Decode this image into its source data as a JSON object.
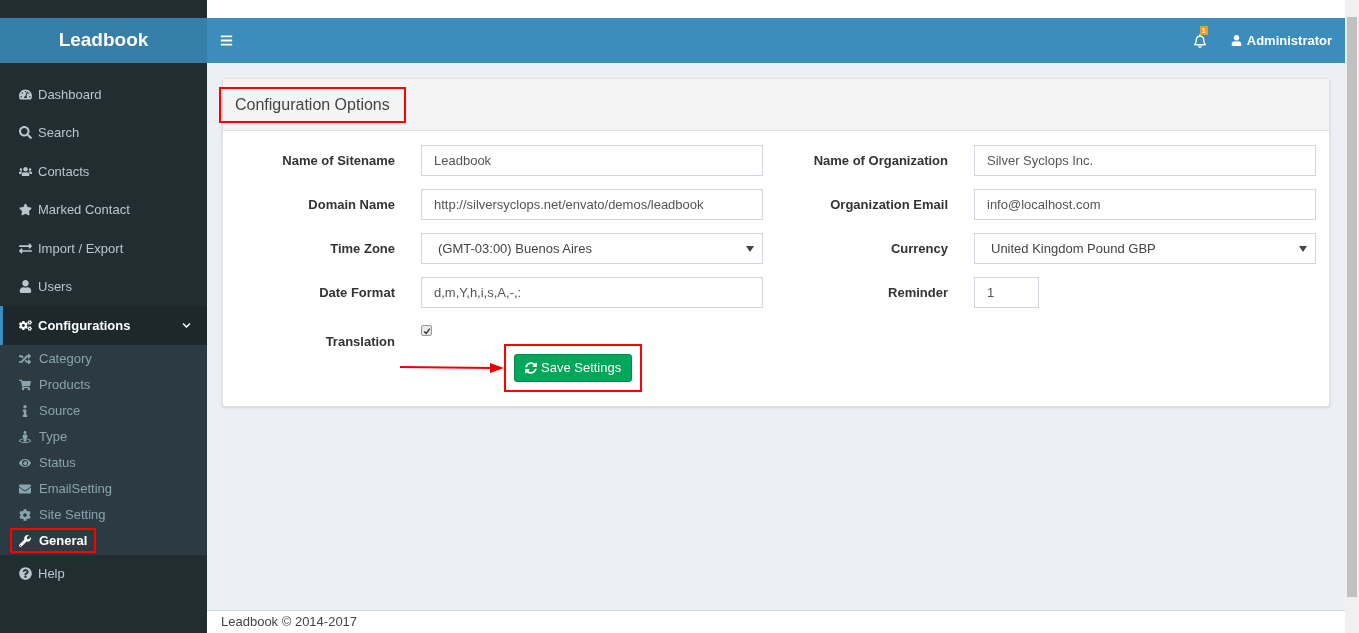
{
  "brand": "Leadbook",
  "sidebar": {
    "items": [
      {
        "label": "Dashboard",
        "selected": false
      },
      {
        "label": "Search",
        "selected": false
      },
      {
        "label": "Contacts",
        "selected": false
      },
      {
        "label": "Marked Contact",
        "selected": false
      },
      {
        "label": "Import / Export",
        "selected": false
      },
      {
        "label": "Users",
        "selected": false
      },
      {
        "label": "Configurations",
        "selected": true,
        "expanded": true,
        "children": [
          {
            "label": "Category",
            "selected": false
          },
          {
            "label": "Products",
            "selected": false
          },
          {
            "label": "Source",
            "selected": false
          },
          {
            "label": "Type",
            "selected": false
          },
          {
            "label": "Status",
            "selected": false
          },
          {
            "label": "EmailSetting",
            "selected": false
          },
          {
            "label": "Site Setting",
            "selected": false
          },
          {
            "label": "General",
            "selected": true,
            "highlighted": true
          }
        ]
      },
      {
        "label": "Help",
        "selected": false
      }
    ]
  },
  "header": {
    "notification_count": "1",
    "user": "Administrator"
  },
  "panel": {
    "title": "Configuration Options",
    "title_highlighted": true,
    "left_fields": [
      {
        "kind": "text",
        "label": "Name of Sitename",
        "value": "Leadbook"
      },
      {
        "kind": "text",
        "label": "Domain Name",
        "value": "http://silversyclops.net/envato/demos/leadbook"
      },
      {
        "kind": "select",
        "label": "Time Zone",
        "value": "(GMT-03:00) Buenos Aires"
      },
      {
        "kind": "text",
        "label": "Date Format",
        "value": "d,m,Y,h,i,s,A,-,:"
      },
      {
        "kind": "checkbox",
        "label": "Translation",
        "checked": true
      }
    ],
    "right_fields": [
      {
        "kind": "text",
        "label": "Name of Organization",
        "value": "Silver Syclops Inc."
      },
      {
        "kind": "text",
        "label": "Organization Email",
        "value": "info@localhost.com"
      },
      {
        "kind": "select",
        "label": "Currency",
        "value": "United Kingdom Pound GBP"
      },
      {
        "kind": "short",
        "label": "Reminder",
        "value": "1"
      }
    ],
    "save_button": {
      "label": "Save Settings",
      "highlighted": true
    }
  },
  "footer": {
    "text": "Leadbook © 2014-2017"
  }
}
